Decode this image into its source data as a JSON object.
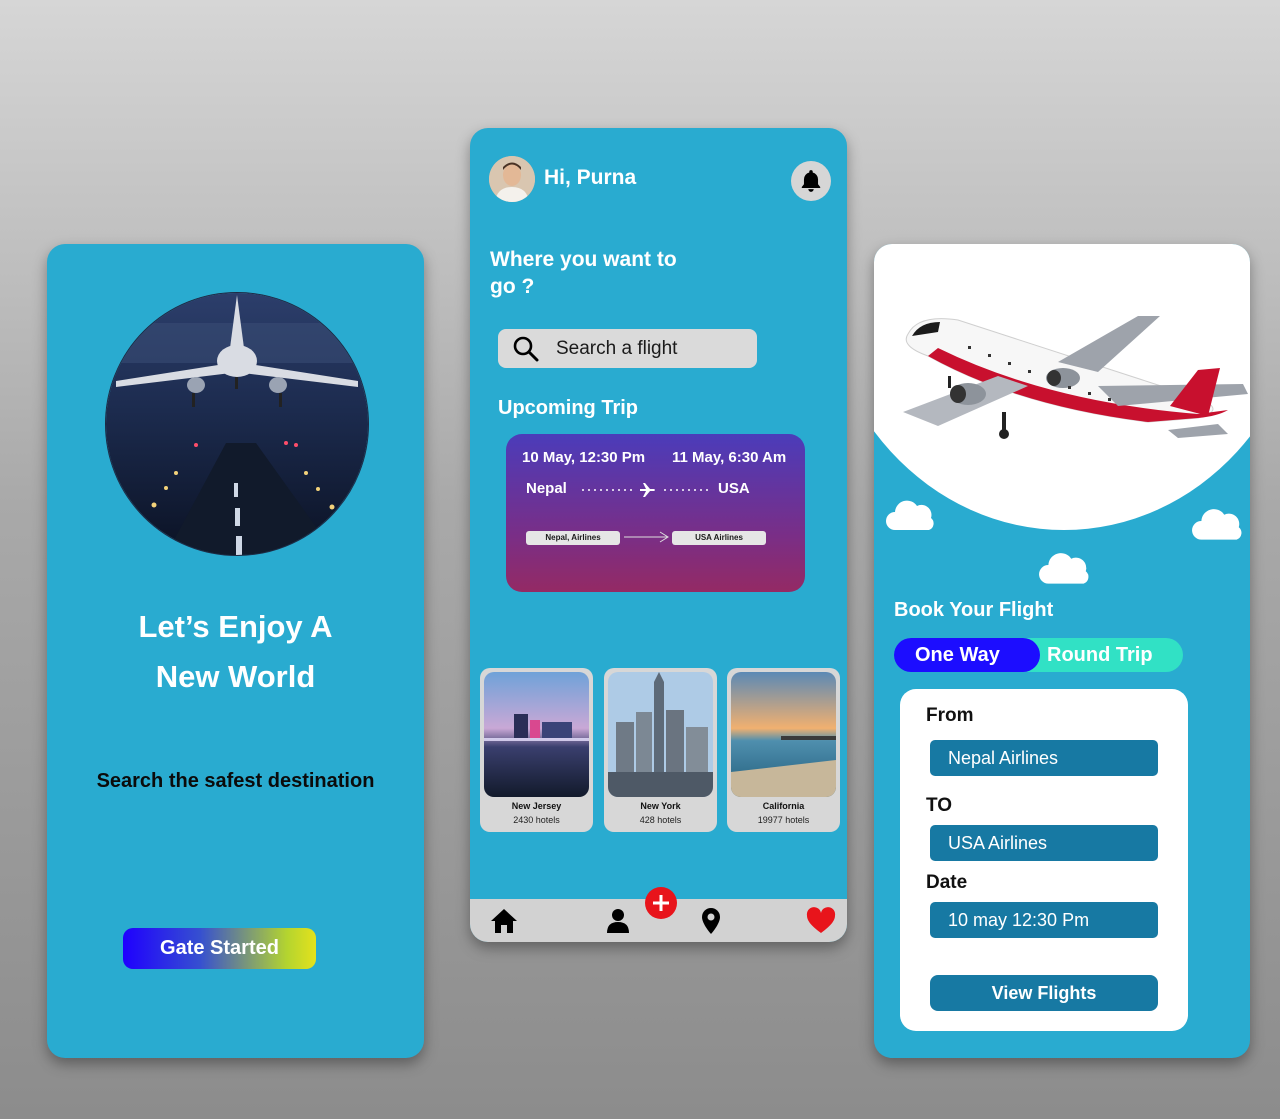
{
  "splash": {
    "title_line1": "Let’s Enjoy  A",
    "title_line2": "New World",
    "subtitle": "Search the safest destination",
    "cta_label": "Gate Started"
  },
  "home": {
    "greeting": "Hi, Purna",
    "prompt_line1": "Where you want to",
    "prompt_line2": "go ?",
    "search_placeholder": "Search a flight",
    "upcoming_label": "Upcoming Trip",
    "trip": {
      "depart_time": "10 May, 12:30 Pm",
      "arrive_time": "11 May, 6:30 Am",
      "from": "Nepal",
      "to": "USA",
      "from_airline": "Nepal, Airlines",
      "to_airline": "USA Airlines"
    },
    "destinations": [
      {
        "name": "New Jersey",
        "hotels": "2430 hotels"
      },
      {
        "name": "New York",
        "hotels": "428 hotels"
      },
      {
        "name": "California",
        "hotels": "19977 hotels"
      }
    ],
    "nav": [
      "home-icon",
      "user-icon",
      "add-icon",
      "location-pin-icon",
      "heart-icon"
    ]
  },
  "booking": {
    "title": "Book Your Flight",
    "one_way": "One Way",
    "round_trip": "Round Trip",
    "from_label": "From",
    "from_value": "Nepal Airlines",
    "to_label": "TO",
    "to_value": "USA Airlines",
    "date_label": "Date",
    "date_value": "10 may 12:30 Pm",
    "cta_label": "View Flights"
  },
  "colors": {
    "screen_bg": "#29abd0",
    "field_bg": "#1779a3",
    "toggle_active": "#1c0dff",
    "toggle_bg": "#31e1c5",
    "favorite": "#e8141b"
  }
}
